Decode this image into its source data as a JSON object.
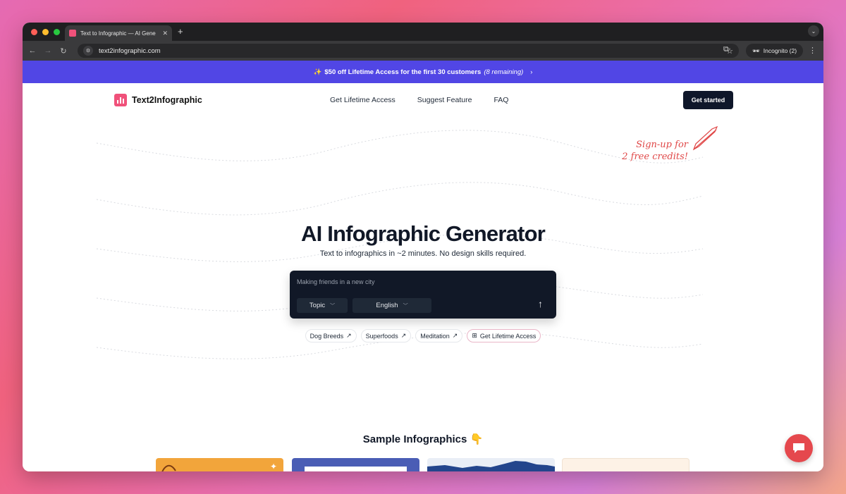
{
  "browser": {
    "tab_title": "Text to Infographic — AI Gene",
    "tab_close": "✕",
    "new_tab": "+",
    "url": "text2infographic.com",
    "incognito_label": "Incognito (2)"
  },
  "banner": {
    "sparkle": "✨",
    "text": "$50 off Lifetime Access for the first 30 customers",
    "remaining": "(8 remaining)",
    "chevron": "›"
  },
  "nav": {
    "brand": "Text2Infographic",
    "links": [
      "Get Lifetime Access",
      "Suggest Feature",
      "FAQ"
    ],
    "cta": "Get started"
  },
  "signup_note": {
    "line1": "Sign-up for",
    "line2": "2 free credits!"
  },
  "hero": {
    "title": "AI Infographic Generator",
    "subtitle": "Text to infographics in ~2 minutes. No design skills required."
  },
  "prompt": {
    "placeholder": "Making friends in a new city",
    "type_select": "Topic",
    "language_select": "English",
    "send": "↑"
  },
  "chips": [
    {
      "label": "Dog Breeds",
      "suffix": "↗"
    },
    {
      "label": "Superfoods",
      "suffix": "↗"
    },
    {
      "label": "Meditation",
      "suffix": "↗"
    },
    {
      "label": "Get Lifetime Access",
      "prefix": "⊞"
    }
  ],
  "samples": {
    "title": "Sample Infographics 👇",
    "card_colors": [
      "#f2a53b",
      "#4a5db5",
      "#e9eef6",
      "#fdf2e6"
    ]
  },
  "colors": {
    "banner": "#5146e5",
    "brand_pink": "#f0517a",
    "dark": "#111827",
    "chat_button": "#e5484d"
  }
}
